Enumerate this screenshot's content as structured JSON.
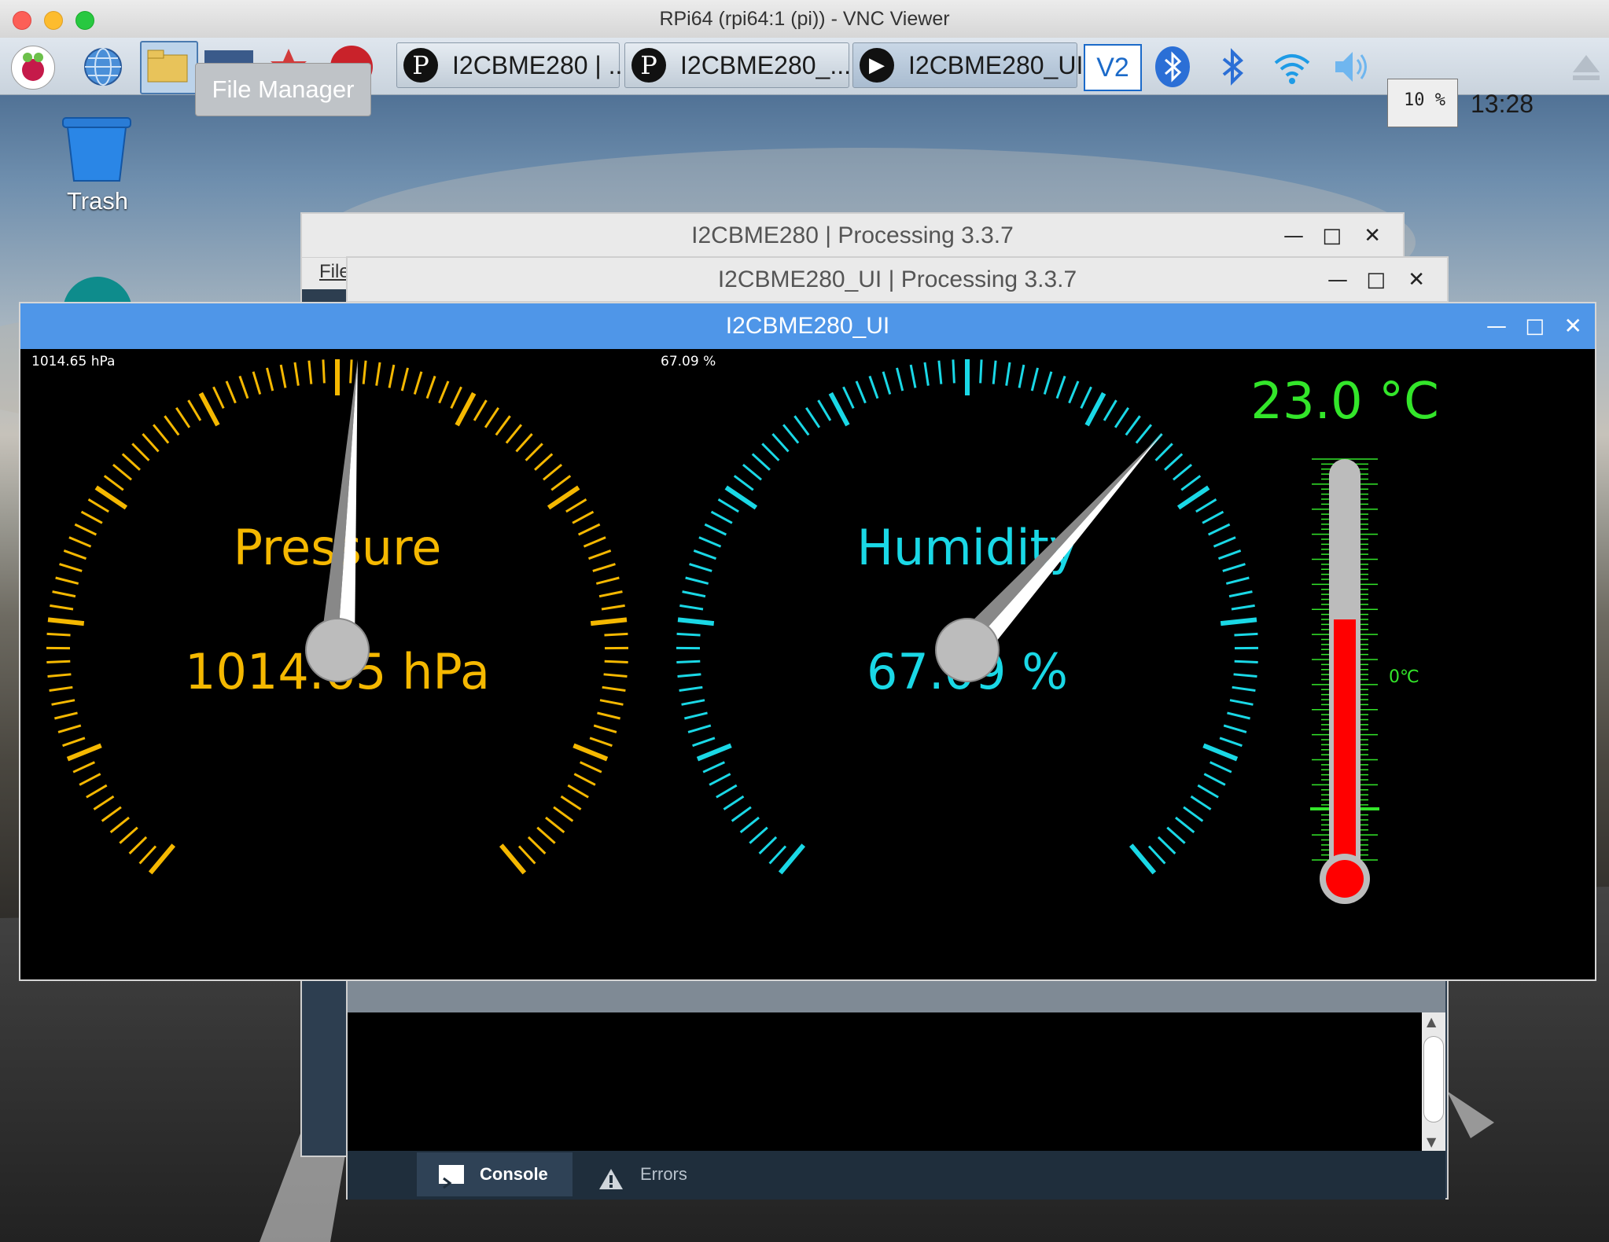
{
  "mac_window": {
    "title": "RPi64 (rpi64:1 (pi)) - VNC Viewer"
  },
  "taskbar": {
    "tooltip": "File Manager",
    "tasks": [
      {
        "label": "I2CBME280 | ..."
      },
      {
        "label": "I2CBME280_..."
      },
      {
        "label": "I2CBME280_UI"
      }
    ],
    "cpu_label": "10 %",
    "clock": "13:28"
  },
  "desktop": {
    "trash_label": "Trash"
  },
  "window_editor": {
    "title": "I2CBME280 | Processing 3.3.7",
    "menu_partial": "File"
  },
  "window_ui_editor": {
    "title": "I2CBME280_UI | Processing 3.3.7",
    "tabs": [
      {
        "label": "Console"
      },
      {
        "label": "Errors"
      }
    ]
  },
  "app_window": {
    "title": "I2CBME280_UI",
    "pressure": {
      "corner_label": "1014.65 hPa",
      "title": "Pressure",
      "readout": "1014.65 hPa",
      "value": 1014.65,
      "unit": "hPa",
      "color": "#f5b800"
    },
    "humidity": {
      "corner_label": "67.09 %",
      "title": "Humidity",
      "readout": "67.09 %",
      "value": 67.09,
      "unit": "%",
      "color": "#1ad8e6"
    },
    "temperature": {
      "readout": "23.0 °C",
      "value": 23.0,
      "zero_label": "0℃",
      "fill_fraction": 0.6,
      "color": "#33e62a",
      "mercury_color": "#ff0000"
    }
  }
}
